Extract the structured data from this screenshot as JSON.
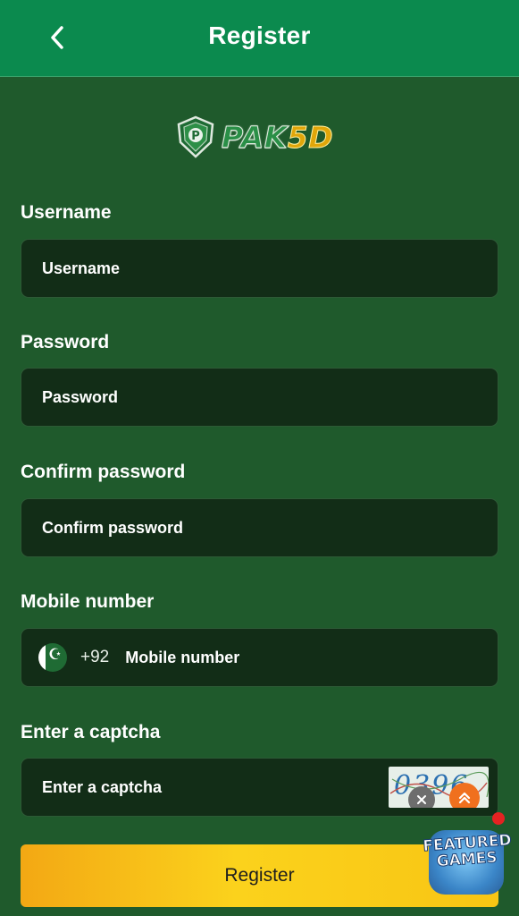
{
  "header": {
    "title": "Register",
    "back_icon": "chevron-left-icon"
  },
  "logo": {
    "text_letters": "PAK",
    "text_number": "5D"
  },
  "form": {
    "username": {
      "label": "Username",
      "placeholder": "Username"
    },
    "password": {
      "label": "Password",
      "placeholder": "Password"
    },
    "confirm_password": {
      "label": "Confirm password",
      "placeholder": "Confirm password"
    },
    "mobile": {
      "label": "Mobile number",
      "dial_code": "+92",
      "placeholder": "Mobile number",
      "flag_icon": "pakistan-flag-icon"
    },
    "captcha": {
      "label": "Enter a captcha",
      "placeholder": "Enter a captcha",
      "image_text": "0396"
    }
  },
  "register_button": {
    "label": "Register"
  },
  "featured_games": {
    "text_line1": "FEATURED",
    "text_line2": "GAMES"
  },
  "colors": {
    "background": "#1f5a2c",
    "header": "#0b8a4e",
    "input_bg": "#122d17",
    "button_gradient_start": "#f3a814",
    "button_gradient_end": "#fbd21c"
  }
}
